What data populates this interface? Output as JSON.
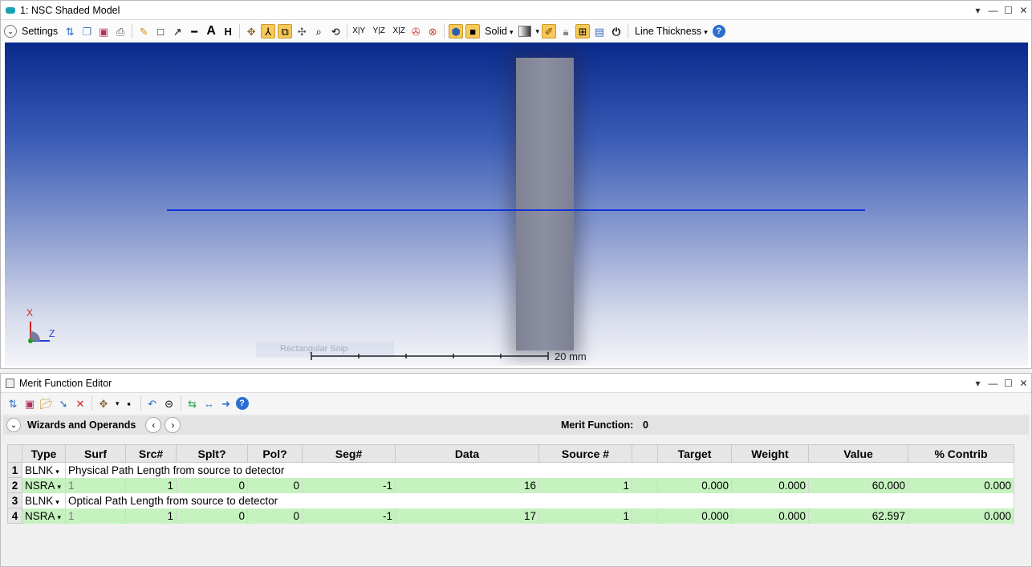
{
  "top_window": {
    "title": "1: NSC Shaded Model",
    "toolbar": {
      "settings_label": "Settings",
      "solid_label": "Solid",
      "line_thickness_label": "Line Thickness"
    },
    "viewport": {
      "axis_x_label": "X",
      "axis_z_label": "Z",
      "scale_label": "20 mm",
      "ghost_label": "Rectangular Snip"
    }
  },
  "merit_window": {
    "title": "Merit Function Editor",
    "wizards_label": "Wizards and Operands",
    "merit_function_label": "Merit Function:",
    "merit_function_value": "0",
    "columns": [
      "Type",
      "Surf",
      "Src#",
      "Splt?",
      "Pol?",
      "Seg#",
      "Data",
      "Source #",
      "",
      "Target",
      "Weight",
      "Value",
      "% Contrib"
    ],
    "rows": [
      {
        "num": "1",
        "type": "BLNK",
        "comment": "Physical Path Length from source to detector"
      },
      {
        "num": "2",
        "type": "NSRA",
        "surf": "1",
        "src": "1",
        "splt": "0",
        "pol": "0",
        "seg": "-1",
        "data": "16",
        "source": "1",
        "extra": "",
        "target": "0.000",
        "weight": "0.000",
        "value": "60.000",
        "contrib": "0.000"
      },
      {
        "num": "3",
        "type": "BLNK",
        "comment": "Optical Path Length from source to detector"
      },
      {
        "num": "4",
        "type": "NSRA",
        "surf": "1",
        "src": "1",
        "splt": "0",
        "pol": "0",
        "seg": "-1",
        "data": "17",
        "source": "1",
        "extra": "",
        "target": "0.000",
        "weight": "0.000",
        "value": "62.597",
        "contrib": "0.000"
      }
    ]
  },
  "colors": {
    "accent_highlight": "#f7c85a",
    "ray": "#1432d8",
    "row_green": "#c6f2c0",
    "viewport_top": "#0a2a8c"
  }
}
